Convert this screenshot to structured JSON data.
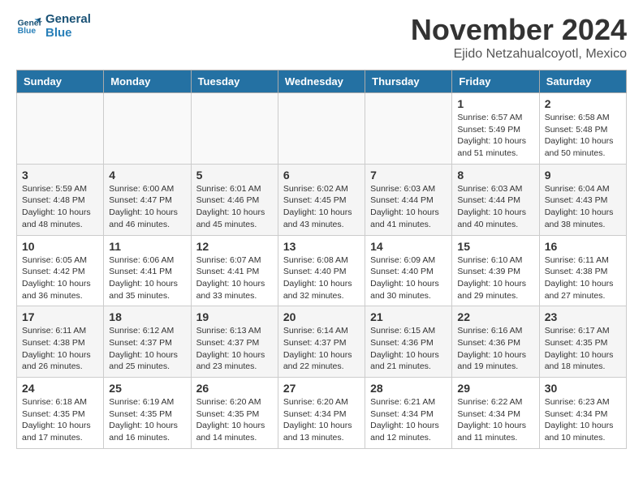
{
  "header": {
    "logo_line1": "General",
    "logo_line2": "Blue",
    "month": "November 2024",
    "location": "Ejido Netzahualcoyotl, Mexico"
  },
  "weekdays": [
    "Sunday",
    "Monday",
    "Tuesday",
    "Wednesday",
    "Thursday",
    "Friday",
    "Saturday"
  ],
  "weeks": [
    [
      {
        "day": "",
        "info": ""
      },
      {
        "day": "",
        "info": ""
      },
      {
        "day": "",
        "info": ""
      },
      {
        "day": "",
        "info": ""
      },
      {
        "day": "",
        "info": ""
      },
      {
        "day": "1",
        "info": "Sunrise: 6:57 AM\nSunset: 5:49 PM\nDaylight: 10 hours\nand 51 minutes."
      },
      {
        "day": "2",
        "info": "Sunrise: 6:58 AM\nSunset: 5:48 PM\nDaylight: 10 hours\nand 50 minutes."
      }
    ],
    [
      {
        "day": "3",
        "info": "Sunrise: 5:59 AM\nSunset: 4:48 PM\nDaylight: 10 hours\nand 48 minutes."
      },
      {
        "day": "4",
        "info": "Sunrise: 6:00 AM\nSunset: 4:47 PM\nDaylight: 10 hours\nand 46 minutes."
      },
      {
        "day": "5",
        "info": "Sunrise: 6:01 AM\nSunset: 4:46 PM\nDaylight: 10 hours\nand 45 minutes."
      },
      {
        "day": "6",
        "info": "Sunrise: 6:02 AM\nSunset: 4:45 PM\nDaylight: 10 hours\nand 43 minutes."
      },
      {
        "day": "7",
        "info": "Sunrise: 6:03 AM\nSunset: 4:44 PM\nDaylight: 10 hours\nand 41 minutes."
      },
      {
        "day": "8",
        "info": "Sunrise: 6:03 AM\nSunset: 4:44 PM\nDaylight: 10 hours\nand 40 minutes."
      },
      {
        "day": "9",
        "info": "Sunrise: 6:04 AM\nSunset: 4:43 PM\nDaylight: 10 hours\nand 38 minutes."
      }
    ],
    [
      {
        "day": "10",
        "info": "Sunrise: 6:05 AM\nSunset: 4:42 PM\nDaylight: 10 hours\nand 36 minutes."
      },
      {
        "day": "11",
        "info": "Sunrise: 6:06 AM\nSunset: 4:41 PM\nDaylight: 10 hours\nand 35 minutes."
      },
      {
        "day": "12",
        "info": "Sunrise: 6:07 AM\nSunset: 4:41 PM\nDaylight: 10 hours\nand 33 minutes."
      },
      {
        "day": "13",
        "info": "Sunrise: 6:08 AM\nSunset: 4:40 PM\nDaylight: 10 hours\nand 32 minutes."
      },
      {
        "day": "14",
        "info": "Sunrise: 6:09 AM\nSunset: 4:40 PM\nDaylight: 10 hours\nand 30 minutes."
      },
      {
        "day": "15",
        "info": "Sunrise: 6:10 AM\nSunset: 4:39 PM\nDaylight: 10 hours\nand 29 minutes."
      },
      {
        "day": "16",
        "info": "Sunrise: 6:11 AM\nSunset: 4:38 PM\nDaylight: 10 hours\nand 27 minutes."
      }
    ],
    [
      {
        "day": "17",
        "info": "Sunrise: 6:11 AM\nSunset: 4:38 PM\nDaylight: 10 hours\nand 26 minutes."
      },
      {
        "day": "18",
        "info": "Sunrise: 6:12 AM\nSunset: 4:37 PM\nDaylight: 10 hours\nand 25 minutes."
      },
      {
        "day": "19",
        "info": "Sunrise: 6:13 AM\nSunset: 4:37 PM\nDaylight: 10 hours\nand 23 minutes."
      },
      {
        "day": "20",
        "info": "Sunrise: 6:14 AM\nSunset: 4:37 PM\nDaylight: 10 hours\nand 22 minutes."
      },
      {
        "day": "21",
        "info": "Sunrise: 6:15 AM\nSunset: 4:36 PM\nDaylight: 10 hours\nand 21 minutes."
      },
      {
        "day": "22",
        "info": "Sunrise: 6:16 AM\nSunset: 4:36 PM\nDaylight: 10 hours\nand 19 minutes."
      },
      {
        "day": "23",
        "info": "Sunrise: 6:17 AM\nSunset: 4:35 PM\nDaylight: 10 hours\nand 18 minutes."
      }
    ],
    [
      {
        "day": "24",
        "info": "Sunrise: 6:18 AM\nSunset: 4:35 PM\nDaylight: 10 hours\nand 17 minutes."
      },
      {
        "day": "25",
        "info": "Sunrise: 6:19 AM\nSunset: 4:35 PM\nDaylight: 10 hours\nand 16 minutes."
      },
      {
        "day": "26",
        "info": "Sunrise: 6:20 AM\nSunset: 4:35 PM\nDaylight: 10 hours\nand 14 minutes."
      },
      {
        "day": "27",
        "info": "Sunrise: 6:20 AM\nSunset: 4:34 PM\nDaylight: 10 hours\nand 13 minutes."
      },
      {
        "day": "28",
        "info": "Sunrise: 6:21 AM\nSunset: 4:34 PM\nDaylight: 10 hours\nand 12 minutes."
      },
      {
        "day": "29",
        "info": "Sunrise: 6:22 AM\nSunset: 4:34 PM\nDaylight: 10 hours\nand 11 minutes."
      },
      {
        "day": "30",
        "info": "Sunrise: 6:23 AM\nSunset: 4:34 PM\nDaylight: 10 hours\nand 10 minutes."
      }
    ]
  ]
}
